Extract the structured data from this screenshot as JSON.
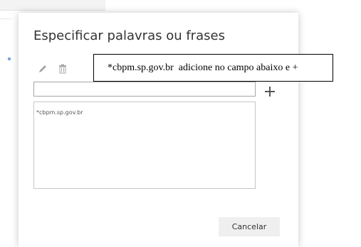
{
  "dialog": {
    "title": "Especificar palavras ou frases",
    "input_value": "",
    "list_items": [
      "*cbpm.sp.gov.br"
    ],
    "cancel_label": "Cancelar"
  },
  "icons": {
    "edit": "pencil-icon",
    "delete": "trash-icon",
    "add": "plus-icon"
  },
  "callout": {
    "text": "*cbpm.sp.gov.br  adicione no campo abaixo e +"
  },
  "colors": {
    "icon": "#9a9a9a",
    "plus": "#555555",
    "button_bg": "#efefef",
    "border": "#a6a6a6"
  }
}
